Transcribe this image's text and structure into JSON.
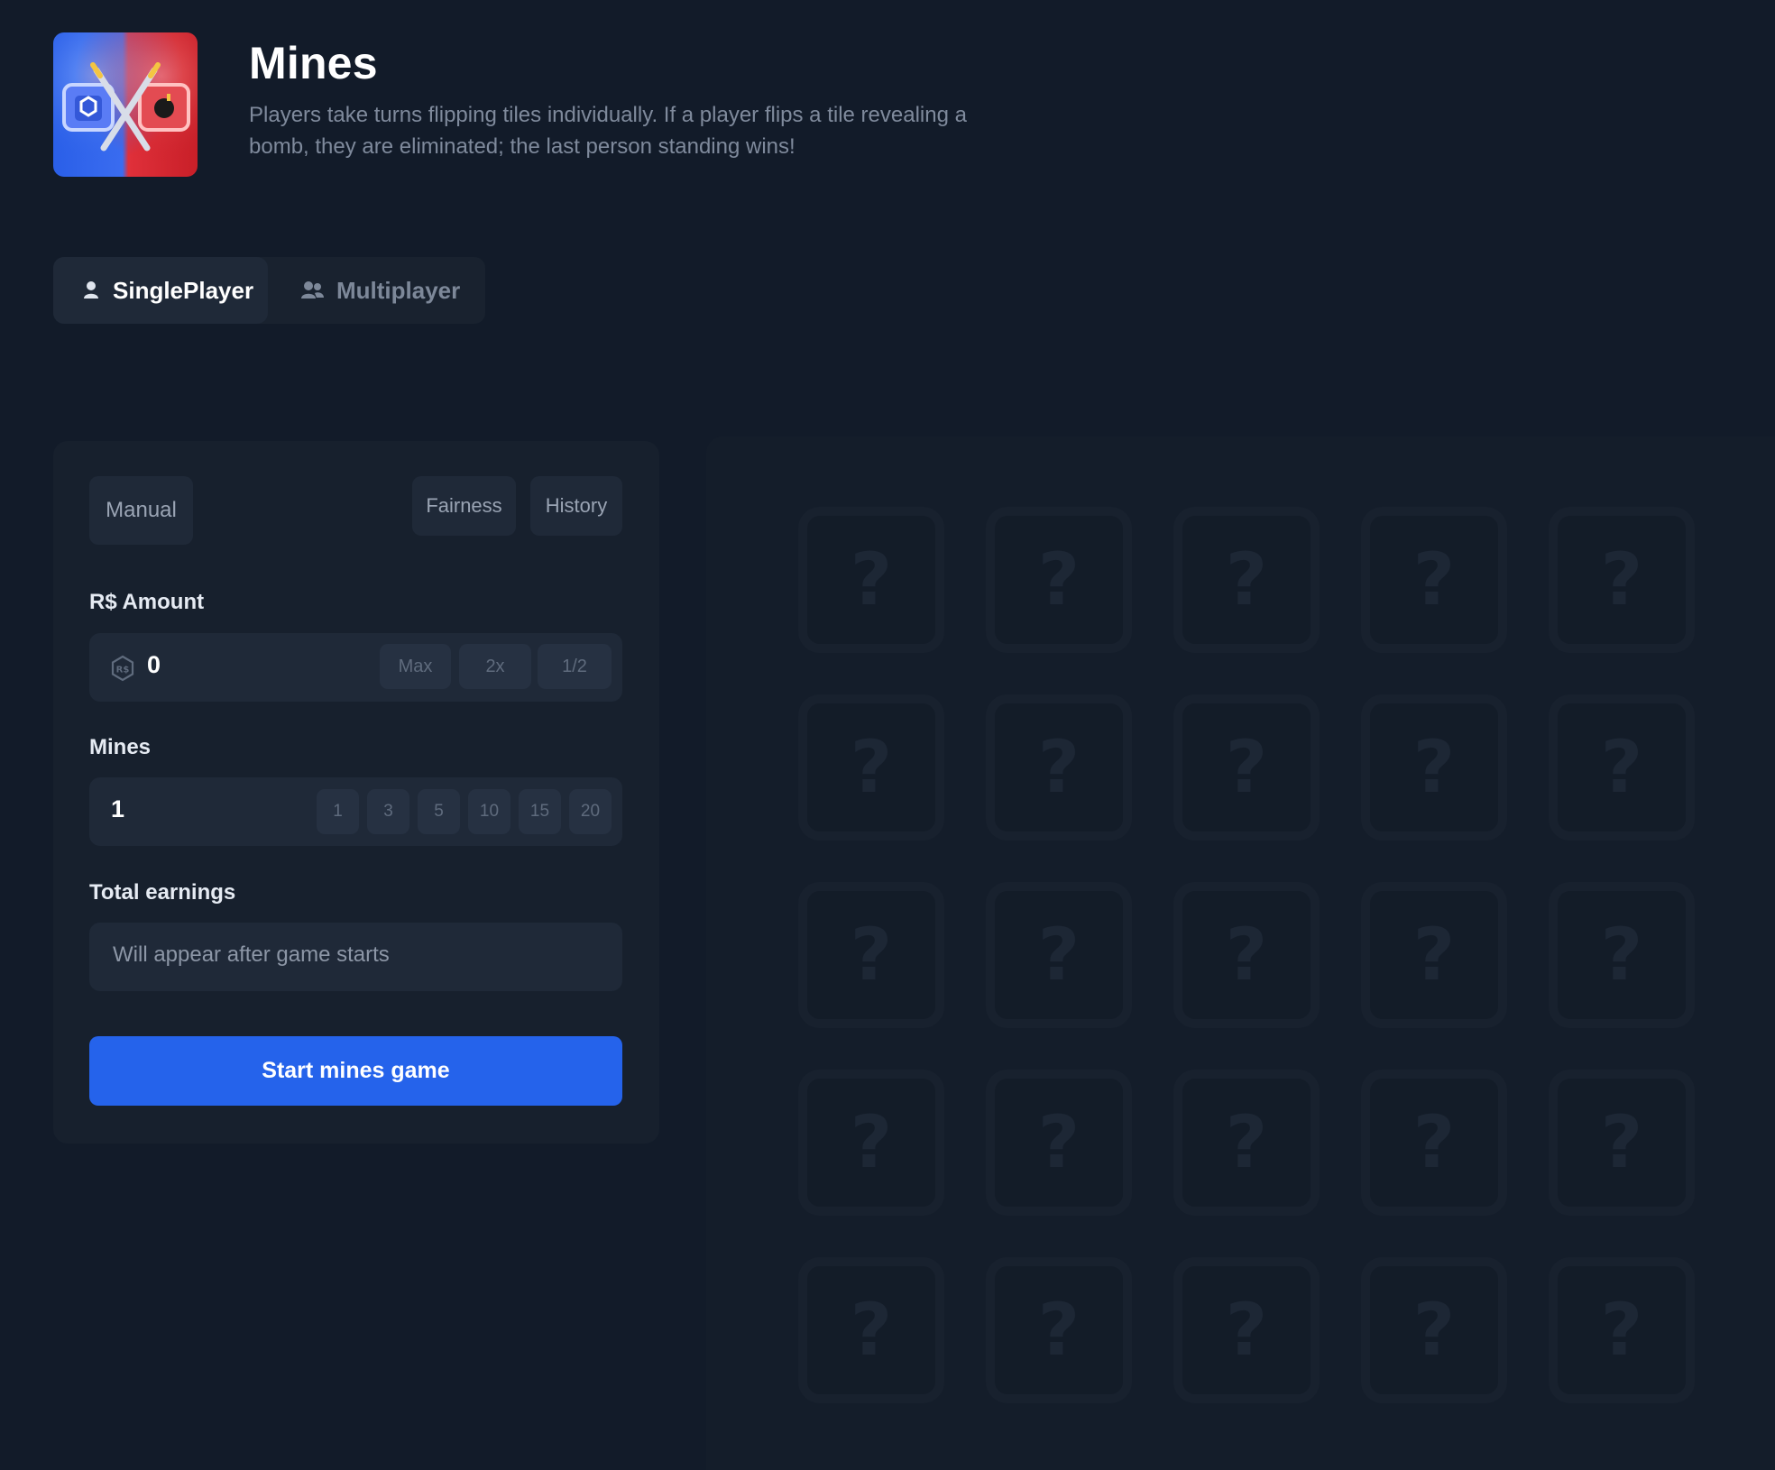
{
  "header": {
    "title": "Mines",
    "description": "Players take turns flipping tiles individually. If a player flips a tile revealing a bomb, they are eliminated; the last person standing wins!",
    "thumbnail_icon": "mines-game-thumbnail"
  },
  "mode_tabs": [
    {
      "label": "SinglePlayer",
      "icon": "user-icon",
      "active": true
    },
    {
      "label": "Multiplayer",
      "icon": "users-icon",
      "active": false
    }
  ],
  "panel": {
    "manual_label": "Manual",
    "fairness_label": "Fairness",
    "history_label": "History",
    "amount": {
      "label": "R$ Amount",
      "value": "0",
      "currency_icon": "robux-coin-icon",
      "quick_buttons": [
        "Max",
        "2x",
        "1/2"
      ]
    },
    "mines": {
      "label": "Mines",
      "value": "1",
      "presets": [
        "1",
        "3",
        "5",
        "10",
        "15",
        "20"
      ]
    },
    "earnings": {
      "label": "Total earnings",
      "placeholder": "Will appear after game starts"
    },
    "start_label": "Start mines game"
  },
  "board": {
    "rows": 5,
    "cols": 5,
    "tile_symbol": "?"
  },
  "colors": {
    "background": "#121b29",
    "accent": "#2563eb"
  }
}
